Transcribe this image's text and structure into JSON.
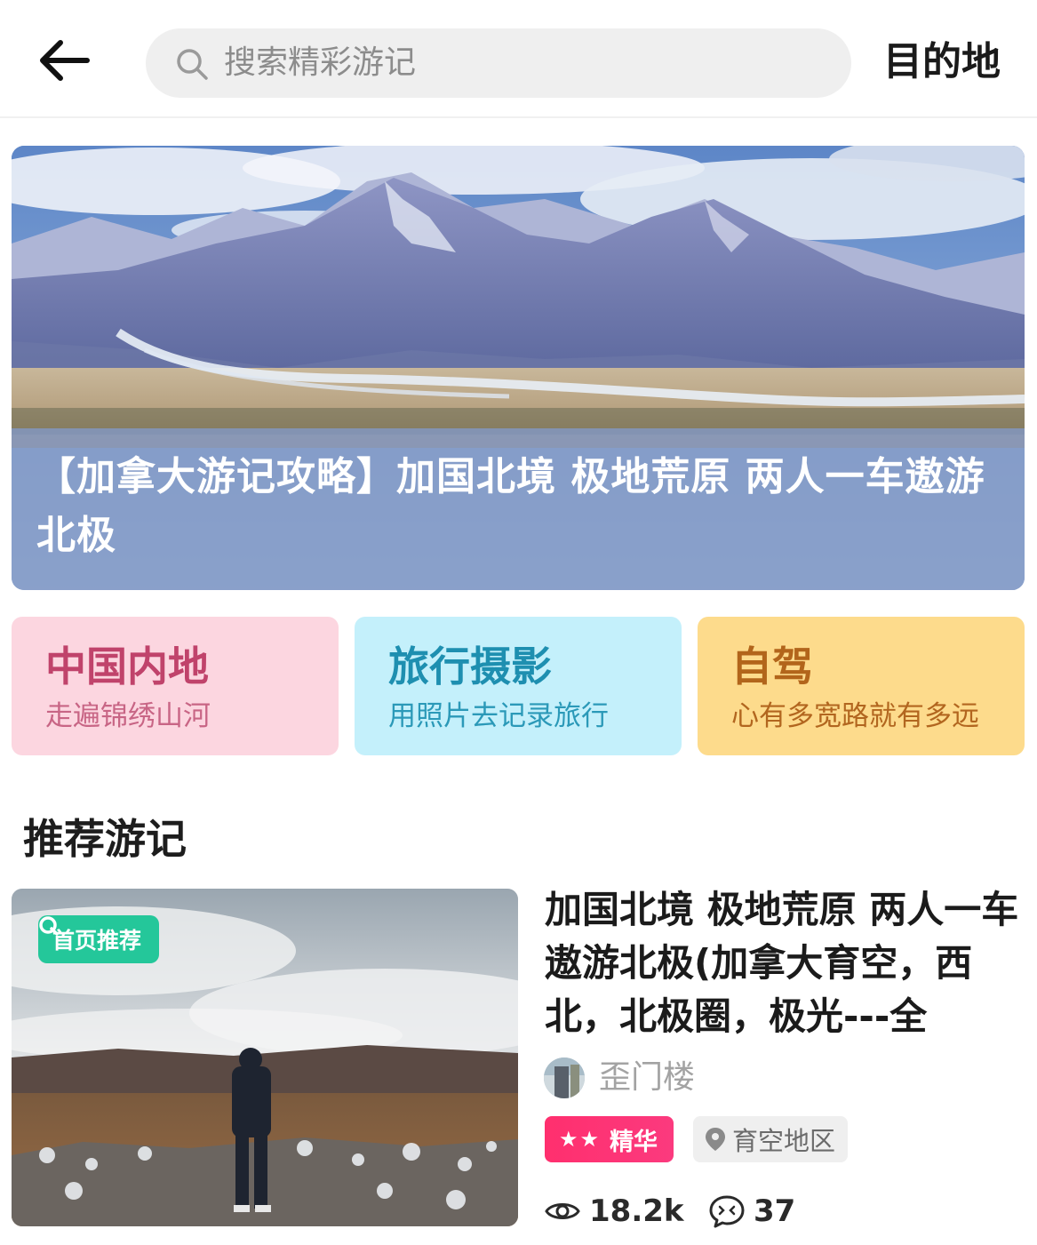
{
  "header": {
    "search_placeholder": "搜索精彩游记",
    "destination_label": "目的地"
  },
  "hero": {
    "title": "【加拿大游记攻略】加国北境 极地荒原 两人一车遨游北极"
  },
  "categories": [
    {
      "title": "中国内地",
      "subtitle": "走遍锦绣山河"
    },
    {
      "title": "旅行摄影",
      "subtitle": "用照片去记录旅行"
    },
    {
      "title": "自驾",
      "subtitle": "心有多宽路就有多远"
    }
  ],
  "section": {
    "title": "推荐游记"
  },
  "article": {
    "badge": "首页推荐",
    "title": "加国北境 极地荒原 两人一车 遨游北极(加拿大育空，西北，北极圈，极光---全",
    "author": "歪门楼",
    "tag_elite": "精华",
    "tag_elite_stars": "★★",
    "location": "育空地区",
    "views": "18.2k",
    "comments": "37"
  },
  "colors": {
    "badge_green": "#24c79a",
    "elite_pink": "#ff2f6e",
    "cat_pink": "#fcd6e0",
    "cat_cyan": "#c4f0fb",
    "cat_yellow": "#fddb8c"
  }
}
